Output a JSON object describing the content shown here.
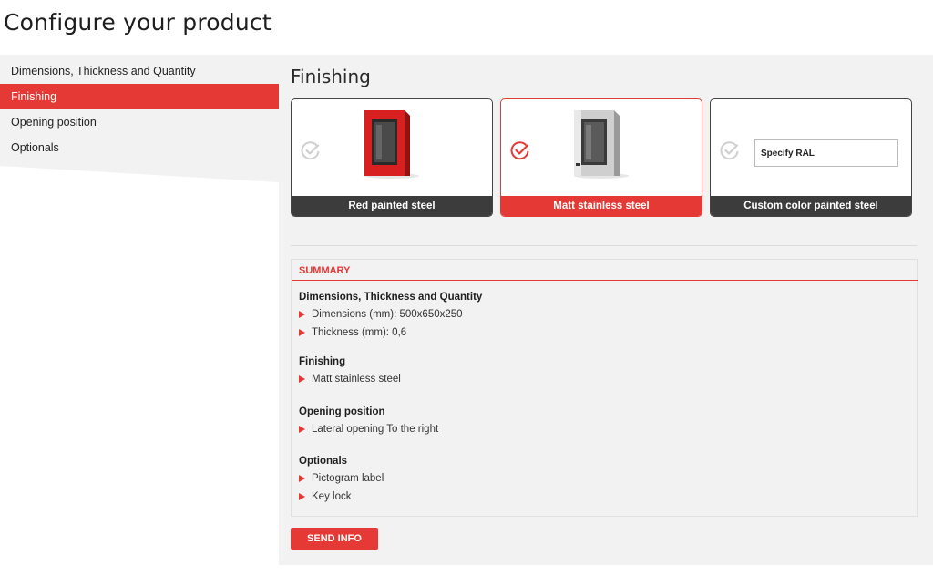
{
  "page": {
    "title": "Configure your product"
  },
  "sidebar": {
    "items": [
      {
        "label": "Dimensions, Thickness and Quantity"
      },
      {
        "label": "Finishing"
      },
      {
        "label": "Opening position"
      },
      {
        "label": "Optionals"
      }
    ],
    "active_index": 1
  },
  "finishing": {
    "title": "Finishing",
    "cards": [
      {
        "label": "Red painted steel",
        "selected": false,
        "icon": "check-circle-icon"
      },
      {
        "label": "Matt stainless steel",
        "selected": true,
        "icon": "check-circle-icon"
      },
      {
        "label": "Custom color painted steel",
        "selected": false,
        "icon": "check-circle-icon"
      }
    ],
    "ral_input": {
      "placeholder": "Specify RAL",
      "value": ""
    }
  },
  "summary": {
    "heading": "SUMMARY",
    "groups": [
      {
        "title": "Dimensions, Thickness and Quantity",
        "items": [
          "Dimensions (mm): 500x650x250",
          "Thickness (mm): 0,6"
        ]
      },
      {
        "title": "Finishing",
        "items": [
          "Matt stainless steel"
        ]
      },
      {
        "title": "Opening position",
        "items": [
          "Lateral opening To the right"
        ]
      },
      {
        "title": "Optionals",
        "items": [
          "Pictogram label",
          "Key lock"
        ]
      }
    ]
  },
  "actions": {
    "send_label": "SEND INFO"
  },
  "colors": {
    "accent": "#e53935",
    "card_footer": "#3c3c3c",
    "panel_bg": "#f2f2f2"
  }
}
